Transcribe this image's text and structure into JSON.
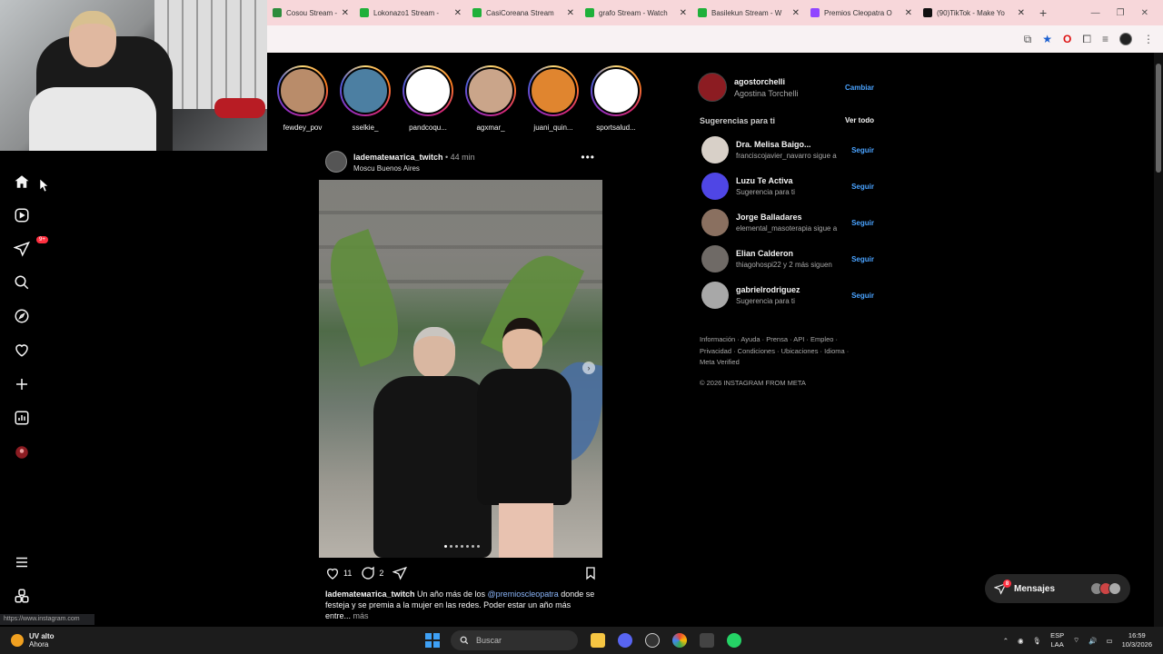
{
  "browser": {
    "tabs": [
      {
        "title": "Cosou Stream - W",
        "color": "#2d8c3c"
      },
      {
        "title": "Lokonazo1 Stream -",
        "color": "#1fb03a"
      },
      {
        "title": "CasiCoreana Stream",
        "color": "#1fb03a"
      },
      {
        "title": "grafo Stream - Watch",
        "color": "#1fb03a"
      },
      {
        "title": "Basilekun Stream - W",
        "color": "#1fb03a"
      },
      {
        "title": "Premios Cleopatra O",
        "color": "#9146ff"
      },
      {
        "title": "(90)TikTok - Make Yo",
        "color": "#111111"
      }
    ],
    "new_tab": "+",
    "url_hint": "https://www.instagram.com"
  },
  "nav": {
    "messages_badge": "9+"
  },
  "stories": [
    {
      "name": "fewdey_pov",
      "color": "#b98c6a"
    },
    {
      "name": "sselkie_",
      "color": "#4c7fa2"
    },
    {
      "name": "pandcoqu...",
      "color": "#ffffff"
    },
    {
      "name": "agxmar_",
      "color": "#caa58a"
    },
    {
      "name": "juani_quin...",
      "color": "#e0852f"
    },
    {
      "name": "sportsalud...",
      "color": "#ffffff"
    }
  ],
  "post": {
    "username": "lademateматica_twitch",
    "time": "44 min",
    "location": "Moscu Buenos Aires",
    "likes": "11",
    "comments": "2",
    "caption_user": "lademateматica_twitch",
    "caption_pre": " Un año más de los ",
    "caption_mention": "@premioscleopatra",
    "caption_post": " donde se festeja y se premia a la mujer en las redes. Poder estar un año más entre...",
    "caption_more": " más",
    "dots_total": 7,
    "dots_active": 0
  },
  "account": {
    "username": "agostorchelli",
    "full_name": "Agostina Torchelli",
    "switch_label": "Cambiar"
  },
  "suggestions": {
    "heading": "Sugerencias para ti",
    "see_all": "Ver todo",
    "follow_label": "Seguir",
    "items": [
      {
        "username": "Dra. Melisa Baigo...",
        "sub": "franciscojavier_navarro sigue a",
        "color": "#d8d0c8"
      },
      {
        "username": "Luzu Te Activa",
        "sub": "Sugerencia para ti",
        "color": "#4f46e5"
      },
      {
        "username": "Jorge Balladares",
        "sub": "elemental_masoterapia sigue a",
        "color": "#8a7060"
      },
      {
        "username": "Elian Calderon",
        "sub": "thiagohospi22 y 2 más siguen",
        "color": "#6f6a66"
      },
      {
        "username": "gabrielrodriguez",
        "sub": "Sugerencia para ti",
        "color": "#a8a8a8"
      }
    ]
  },
  "footer": {
    "links": "Información · Ayuda · Prensa · API · Empleo · Privacidad · Condiciones · Ubicaciones · Idioma · Meta Verified",
    "copyright": "© 2026 INSTAGRAM FROM META"
  },
  "messages": {
    "label": "Mensajes",
    "badge": "8"
  },
  "taskbar": {
    "weather_title": "UV alto",
    "weather_sub": "Ahora",
    "search_placeholder": "Buscar",
    "lang_1": "ESP",
    "lang_2": "LAA",
    "time": "16:59",
    "date": "10/3/2026"
  }
}
